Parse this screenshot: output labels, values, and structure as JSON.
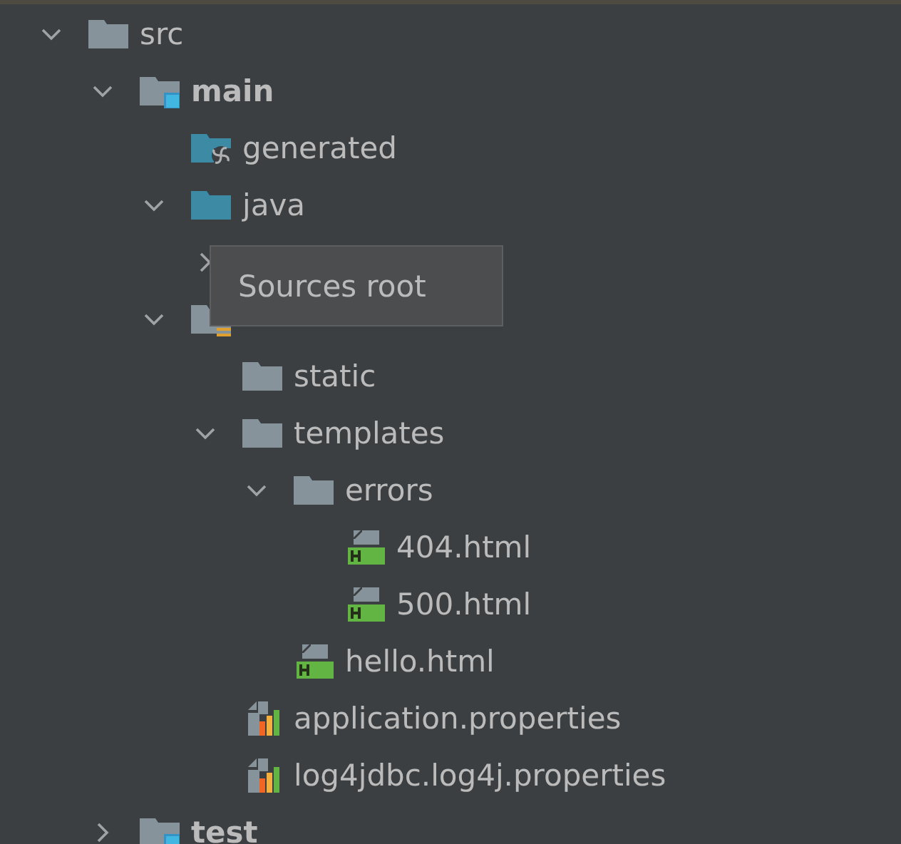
{
  "tree": [
    {
      "name": "src",
      "kind": "folder",
      "expanded": true,
      "children": [
        {
          "name": "main",
          "kind": "source-root",
          "bold": true,
          "expanded": true,
          "children": [
            {
              "name": "generated",
              "kind": "generated-folder"
            },
            {
              "name": "java",
              "kind": "sources-folder",
              "expanded": true,
              "children": [
                {
                  "kind": "hidden",
                  "expanded": false
                }
              ]
            },
            {
              "kind": "resources-folder",
              "expanded": true,
              "children": [
                {
                  "name": "static",
                  "kind": "folder"
                },
                {
                  "name": "templates",
                  "kind": "folder",
                  "expanded": true,
                  "children": [
                    {
                      "name": "errors",
                      "kind": "folder",
                      "expanded": true,
                      "children": [
                        {
                          "name": "404.html",
                          "kind": "html"
                        },
                        {
                          "name": "500.html",
                          "kind": "html"
                        }
                      ]
                    },
                    {
                      "name": "hello.html",
                      "kind": "html"
                    }
                  ]
                },
                {
                  "name": "application.properties",
                  "kind": "properties"
                },
                {
                  "name": "log4jdbc.log4j.properties",
                  "kind": "properties"
                }
              ]
            }
          ]
        },
        {
          "name": "test",
          "kind": "source-root",
          "bold": true,
          "expanded": false
        }
      ]
    }
  ],
  "tooltip": {
    "text": "Sources root"
  }
}
